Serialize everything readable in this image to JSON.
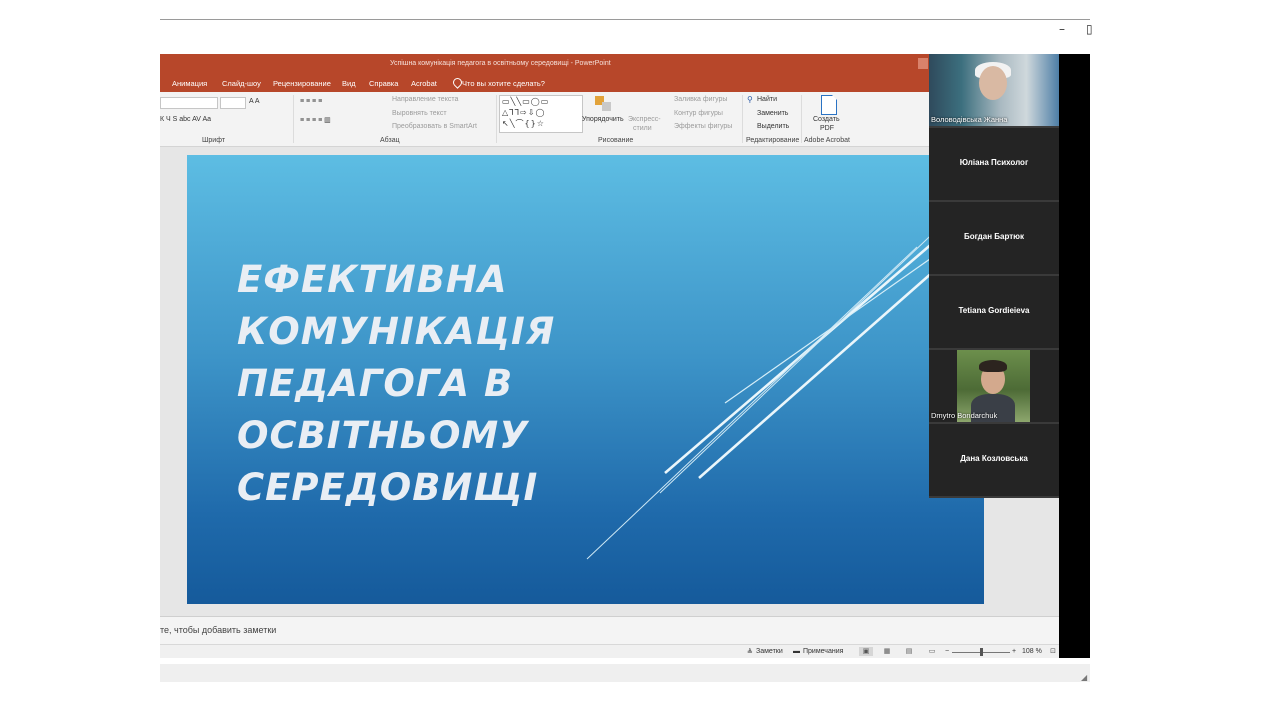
{
  "window_controls": {
    "minimize": "–",
    "maximize": "▯"
  },
  "powerpoint": {
    "title": "Успішна комунікація педагога в освітньому середовищі  -  PowerPoint",
    "ribbon_tabs": [
      "Анимация",
      "Слайд-шоу",
      "Рецензирование",
      "Вид",
      "Справка",
      "Acrobat"
    ],
    "tell_me": "Что вы хотите сделать?",
    "ribbon": {
      "font_group_label": "Шрифт",
      "paragraph_group_label": "Абзац",
      "drawing_group_label": "Рисование",
      "editing_group_label": "Редактирование",
      "acrobat_group_label": "Adobe Acrobat",
      "text_direction": "Направление текста",
      "align_text": "Выровнять текст",
      "convert_smartart": "Преобразовать в SmartArt",
      "arrange": "Упорядочить",
      "quick_styles_1": "Экспресс-",
      "quick_styles_2": "стили",
      "shape_fill": "Заливка фигуры",
      "shape_outline": "Контур фигуры",
      "shape_effects": "Эффекты фигуры",
      "find": "Найти",
      "replace": "Заменить",
      "select": "Выделить",
      "create_pdf_1": "Создать",
      "create_pdf_2": "PDF",
      "font_buttons": "К  Ч  S  abc  AV  Aa",
      "font_size_buttons": "A  A",
      "para_buttons_1": "≡  ≡  ≡  ≡",
      "para_buttons_2": "≡  ≡  ≡  ≡  ▥"
    },
    "slide": {
      "title_lines": [
        "ЕФЕКТИВНА КОМУНІКАЦІЯ",
        "ПЕДАГОГА В ОСВІТНЬОМУ",
        "СЕРЕДОВИЩІ"
      ]
    },
    "notes_placeholder": "те, чтобы добавить заметки",
    "status": {
      "notes_button": "Заметки",
      "comments_button": "Примечания",
      "zoom_minus": "−",
      "zoom_plus": "+",
      "zoom_level": "108 %"
    }
  },
  "participants": [
    {
      "name": "Воловодівська Жанна",
      "video": true
    },
    {
      "name": "Юліана Психолог",
      "video": false
    },
    {
      "name": "Богдан Бартюк",
      "video": false
    },
    {
      "name": "Tetiana Gordieieva",
      "video": false
    },
    {
      "name": "Dmytro Bondarchuk",
      "video": true
    },
    {
      "name": "Дана Козловська",
      "video": false
    }
  ],
  "colors": {
    "powerpoint_accent": "#b7472a",
    "slide_top": "#5dbde3",
    "slide_bottom": "#155a9b",
    "tile_background": "#242424"
  },
  "icons": [
    "lightbulb-icon",
    "search-icon",
    "pdf-icon",
    "notes-icon",
    "comments-icon",
    "normal-view-icon",
    "slide-sorter-icon",
    "reading-view-icon",
    "slideshow-icon",
    "fit-icon",
    "cursor-icon"
  ]
}
